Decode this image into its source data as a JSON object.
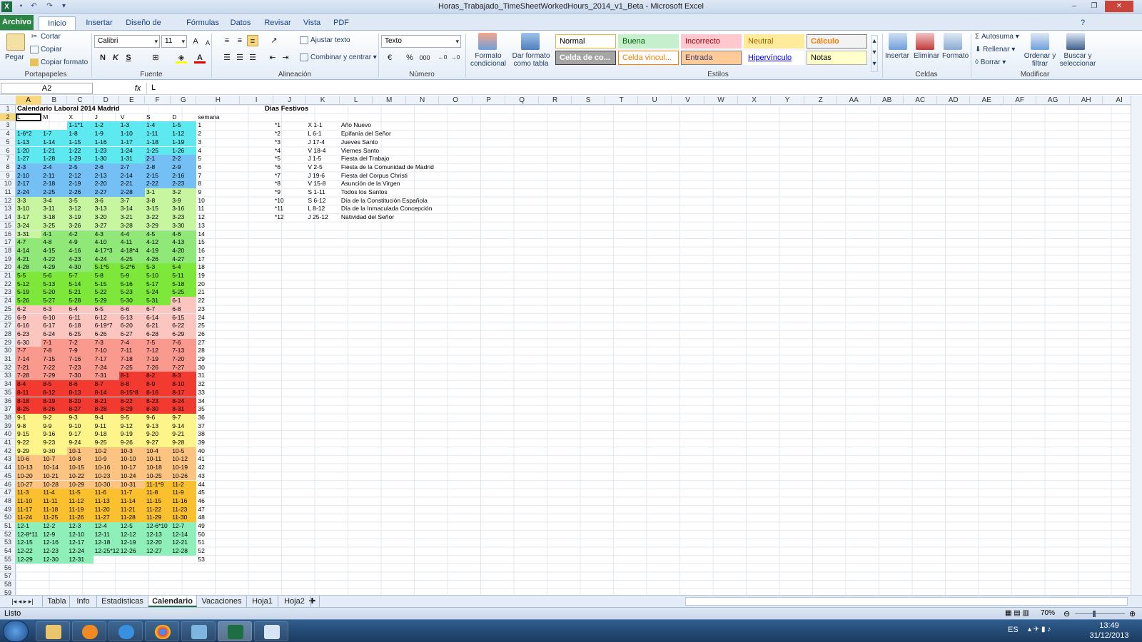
{
  "window": {
    "title": "Horas_Trabajado_TimeSheetWorkedHours_2014_v1_Beta - Microsoft Excel"
  },
  "ribbon_tabs": [
    "Archivo",
    "Inicio",
    "Insertar",
    "Diseño de página",
    "Fórmulas",
    "Datos",
    "Revisar",
    "Vista",
    "PDF"
  ],
  "ribbon": {
    "clipboard": {
      "paste": "Pegar",
      "cut": "Cortar",
      "copy": "Copiar",
      "format_painter": "Copiar formato",
      "label": "Portapapeles"
    },
    "font": {
      "name": "Calibri",
      "size": "11",
      "label": "Fuente",
      "bold": "N",
      "italic": "K",
      "underline": "S"
    },
    "alignment": {
      "wrap": "Ajustar texto",
      "merge": "Combinar y centrar",
      "label": "Alineación"
    },
    "number": {
      "format": "Texto",
      "percent": "%",
      "thousands": "000",
      "label": "Número"
    },
    "styles": {
      "cond_format": "Formato condicional",
      "as_table": "Dar formato como tabla",
      "label": "Estilos",
      "cells": [
        {
          "name": "Normal",
          "bg": "#ffffff",
          "fg": "#000000",
          "border": "#e8b53e"
        },
        {
          "name": "Buena",
          "bg": "#c6efce",
          "fg": "#006100",
          "border": "#c6efce"
        },
        {
          "name": "Incorrecto",
          "bg": "#ffc7ce",
          "fg": "#9c0006",
          "border": "#ffc7ce"
        },
        {
          "name": "Neutral",
          "bg": "#ffeb9c",
          "fg": "#9c6500",
          "border": "#ffeb9c"
        },
        {
          "name": "Cálculo",
          "bg": "#f2f2f2",
          "fg": "#fa7d00",
          "border": "#7f7f7f"
        },
        {
          "name": "Celda de co...",
          "bg": "#a5a5a5",
          "fg": "#ffffff",
          "border": "#3f3f3f"
        },
        {
          "name": "Celda vincul...",
          "bg": "#ffffff",
          "fg": "#fa7d00",
          "border": "#ff8001"
        },
        {
          "name": "Entrada",
          "bg": "#ffcc99",
          "fg": "#3f3f76",
          "border": "#7f7f7f"
        },
        {
          "name": "Hipervínculo",
          "bg": "#ffffff",
          "fg": "#0000ff",
          "border": "#ffffff"
        },
        {
          "name": "Notas",
          "bg": "#ffffcc",
          "fg": "#000000",
          "border": "#b2b2b2"
        }
      ]
    },
    "cells_group": {
      "insert": "Insertar",
      "delete": "Eliminar",
      "format": "Formato",
      "label": "Celdas"
    },
    "edit": {
      "autosum": "Autosuma",
      "fill": "Rellenar",
      "clear": "Borrar",
      "sort": "Ordenar y filtrar",
      "find": "Buscar y seleccionar",
      "label": "Modificar"
    }
  },
  "formula_bar": {
    "name_box": "A2",
    "fx": "fx",
    "value": "L"
  },
  "columns": [
    "A",
    "B",
    "C",
    "D",
    "E",
    "F",
    "G",
    "H",
    "I",
    "J",
    "K",
    "L",
    "M",
    "N",
    "O",
    "P",
    "Q",
    "R",
    "S",
    "T",
    "U",
    "V",
    "W",
    "X",
    "Y",
    "Z",
    "AA",
    "AB",
    "AC",
    "AD",
    "AE",
    "AF",
    "AG",
    "AH",
    "AI"
  ],
  "sheet": {
    "title": "Calendario Laboral 2014 Madrid",
    "weekday_headers": [
      "L",
      "M",
      "X",
      "J",
      "V",
      "S",
      "D",
      "semana"
    ],
    "holidays_title": "Dias Festivos",
    "holidays": [
      [
        "*1",
        "X 1-1",
        "Año Nuevo"
      ],
      [
        "*2",
        "L 6-1",
        "Epifanía del Señor"
      ],
      [
        "*3",
        "J 17-4",
        "Jueves Santo"
      ],
      [
        "*4",
        "V 18-4",
        "Viernes Santo"
      ],
      [
        "*5",
        "J 1-5",
        "Fiesta del Trabajo"
      ],
      [
        "*6",
        "V 2-5",
        "Fiesta de la Comunidad de Madrid"
      ],
      [
        "*7",
        "J 19-6",
        "Fiesta del Corpus Christi"
      ],
      [
        "*8",
        "V 15-8",
        "Asunción de la Virgen"
      ],
      [
        "*9",
        "S 1-11",
        "Todos los Santos"
      ],
      [
        "*10",
        "S 6-12",
        "Día de la Constitución Española"
      ],
      [
        "*11",
        "L 8-12",
        "Día de la Inmaculada Concepción"
      ],
      [
        "*12",
        "J 25-12",
        "Natividad del Señor"
      ]
    ],
    "month_colors": {
      "1": "#5ee8f0",
      "2": "#74c0f5",
      "3": "#c8f5a0",
      "4": "#8fe878",
      "5": "#7ee83a",
      "6": "#fcc6c0",
      "7": "#fa9a8e",
      "8": "#f23a30",
      "9": "#fdf48a",
      "10": "#fcc480",
      "11": "#fbc02d",
      "12": "#8ef0b8"
    },
    "weeks": [
      [
        "",
        "",
        "1-1*1",
        "1-2",
        "1-3",
        "1-4",
        "1-5",
        "1"
      ],
      [
        "1-6*2",
        "1-7",
        "1-8",
        "1-9",
        "1-10",
        "1-11",
        "1-12",
        "2"
      ],
      [
        "1-13",
        "1-14",
        "1-15",
        "1-16",
        "1-17",
        "1-18",
        "1-19",
        "3"
      ],
      [
        "1-20",
        "1-21",
        "1-22",
        "1-23",
        "1-24",
        "1-25",
        "1-26",
        "4"
      ],
      [
        "1-27",
        "1-28",
        "1-29",
        "1-30",
        "1-31",
        "2-1",
        "2-2",
        "5"
      ],
      [
        "2-3",
        "2-4",
        "2-5",
        "2-6",
        "2-7",
        "2-8",
        "2-9",
        "6"
      ],
      [
        "2-10",
        "2-11",
        "2-12",
        "2-13",
        "2-14",
        "2-15",
        "2-16",
        "7"
      ],
      [
        "2-17",
        "2-18",
        "2-19",
        "2-20",
        "2-21",
        "2-22",
        "2-23",
        "8"
      ],
      [
        "2-24",
        "2-25",
        "2-26",
        "2-27",
        "2-28",
        "3-1",
        "3-2",
        "9"
      ],
      [
        "3-3",
        "3-4",
        "3-5",
        "3-6",
        "3-7",
        "3-8",
        "3-9",
        "10"
      ],
      [
        "3-10",
        "3-11",
        "3-12",
        "3-13",
        "3-14",
        "3-15",
        "3-16",
        "11"
      ],
      [
        "3-17",
        "3-18",
        "3-19",
        "3-20",
        "3-21",
        "3-22",
        "3-23",
        "12"
      ],
      [
        "3-24",
        "3-25",
        "3-26",
        "3-27",
        "3-28",
        "3-29",
        "3-30",
        "13"
      ],
      [
        "3-31",
        "4-1",
        "4-2",
        "4-3",
        "4-4",
        "4-5",
        "4-6",
        "14"
      ],
      [
        "4-7",
        "4-8",
        "4-9",
        "4-10",
        "4-11",
        "4-12",
        "4-13",
        "15"
      ],
      [
        "4-14",
        "4-15",
        "4-16",
        "4-17*3",
        "4-18*4",
        "4-19",
        "4-20",
        "16"
      ],
      [
        "4-21",
        "4-22",
        "4-23",
        "4-24",
        "4-25",
        "4-26",
        "4-27",
        "17"
      ],
      [
        "4-28",
        "4-29",
        "4-30",
        "5-1*5",
        "5-2*6",
        "5-3",
        "5-4",
        "18"
      ],
      [
        "5-5",
        "5-6",
        "5-7",
        "5-8",
        "5-9",
        "5-10",
        "5-11",
        "19"
      ],
      [
        "5-12",
        "5-13",
        "5-14",
        "5-15",
        "5-16",
        "5-17",
        "5-18",
        "20"
      ],
      [
        "5-19",
        "5-20",
        "5-21",
        "5-22",
        "5-23",
        "5-24",
        "5-25",
        "21"
      ],
      [
        "5-26",
        "5-27",
        "5-28",
        "5-29",
        "5-30",
        "5-31",
        "6-1",
        "22"
      ],
      [
        "6-2",
        "6-3",
        "6-4",
        "6-5",
        "6-6",
        "6-7",
        "6-8",
        "23"
      ],
      [
        "6-9",
        "6-10",
        "6-11",
        "6-12",
        "6-13",
        "6-14",
        "6-15",
        "24"
      ],
      [
        "6-16",
        "6-17",
        "6-18",
        "6-19*7",
        "6-20",
        "6-21",
        "6-22",
        "25"
      ],
      [
        "6-23",
        "6-24",
        "6-25",
        "6-26",
        "6-27",
        "6-28",
        "6-29",
        "26"
      ],
      [
        "6-30",
        "7-1",
        "7-2",
        "7-3",
        "7-4",
        "7-5",
        "7-6",
        "27"
      ],
      [
        "7-7",
        "7-8",
        "7-9",
        "7-10",
        "7-11",
        "7-12",
        "7-13",
        "28"
      ],
      [
        "7-14",
        "7-15",
        "7-16",
        "7-17",
        "7-18",
        "7-19",
        "7-20",
        "29"
      ],
      [
        "7-21",
        "7-22",
        "7-23",
        "7-24",
        "7-25",
        "7-26",
        "7-27",
        "30"
      ],
      [
        "7-28",
        "7-29",
        "7-30",
        "7-31",
        "8-1",
        "8-2",
        "8-3",
        "31"
      ],
      [
        "8-4",
        "8-5",
        "8-6",
        "8-7",
        "8-8",
        "8-9",
        "8-10",
        "32"
      ],
      [
        "8-11",
        "8-12",
        "8-13",
        "8-14",
        "8-15*8",
        "8-16",
        "8-17",
        "33"
      ],
      [
        "8-18",
        "8-19",
        "8-20",
        "8-21",
        "8-22",
        "8-23",
        "8-24",
        "34"
      ],
      [
        "8-25",
        "8-26",
        "8-27",
        "8-28",
        "8-29",
        "8-30",
        "8-31",
        "35"
      ],
      [
        "9-1",
        "9-2",
        "9-3",
        "9-4",
        "9-5",
        "9-6",
        "9-7",
        "36"
      ],
      [
        "9-8",
        "9-9",
        "9-10",
        "9-11",
        "9-12",
        "9-13",
        "9-14",
        "37"
      ],
      [
        "9-15",
        "9-16",
        "9-17",
        "9-18",
        "9-19",
        "9-20",
        "9-21",
        "38"
      ],
      [
        "9-22",
        "9-23",
        "9-24",
        "9-25",
        "9-26",
        "9-27",
        "9-28",
        "39"
      ],
      [
        "9-29",
        "9-30",
        "10-1",
        "10-2",
        "10-3",
        "10-4",
        "10-5",
        "40"
      ],
      [
        "10-6",
        "10-7",
        "10-8",
        "10-9",
        "10-10",
        "10-11",
        "10-12",
        "41"
      ],
      [
        "10-13",
        "10-14",
        "10-15",
        "10-16",
        "10-17",
        "10-18",
        "10-19",
        "42"
      ],
      [
        "10-20",
        "10-21",
        "10-22",
        "10-23",
        "10-24",
        "10-25",
        "10-26",
        "43"
      ],
      [
        "10-27",
        "10-28",
        "10-29",
        "10-30",
        "10-31",
        "11-1*9",
        "11-2",
        "44"
      ],
      [
        "11-3",
        "11-4",
        "11-5",
        "11-6",
        "11-7",
        "11-8",
        "11-9",
        "45"
      ],
      [
        "11-10",
        "11-11",
        "11-12",
        "11-13",
        "11-14",
        "11-15",
        "11-16",
        "46"
      ],
      [
        "11-17",
        "11-18",
        "11-19",
        "11-20",
        "11-21",
        "11-22",
        "11-23",
        "47"
      ],
      [
        "11-24",
        "11-25",
        "11-26",
        "11-27",
        "11-28",
        "11-29",
        "11-30",
        "48"
      ],
      [
        "12-1",
        "12-2",
        "12-3",
        "12-4",
        "12-5",
        "12-6*10",
        "12-7",
        "49"
      ],
      [
        "12-8*11",
        "12-9",
        "12-10",
        "12-11",
        "12-12",
        "12-13",
        "12-14",
        "50"
      ],
      [
        "12-15",
        "12-16",
        "12-17",
        "12-18",
        "12-19",
        "12-20",
        "12-21",
        "51"
      ],
      [
        "12-22",
        "12-23",
        "12-24",
        "12-25*12",
        "12-26",
        "12-27",
        "12-28",
        "52"
      ],
      [
        "12-29",
        "12-30",
        "12-31",
        "",
        "",
        "",
        "",
        "53"
      ]
    ]
  },
  "sheet_tabs": [
    "Tabla",
    "Info",
    "Estadisticas",
    "Calendario",
    "Vacaciones",
    "Hoja1",
    "Hoja2"
  ],
  "active_sheet": "Calendario",
  "status": {
    "ready": "Listo",
    "zoom": "70%"
  },
  "taskbar": {
    "lang": "ES",
    "time": "13:49",
    "date": "31/12/2013"
  }
}
